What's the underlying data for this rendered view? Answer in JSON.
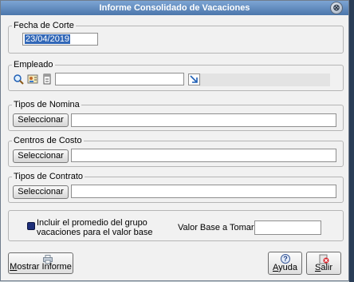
{
  "window": {
    "title": "Informe Consolidado de Vacaciones",
    "close_glyph": "⊗"
  },
  "fecha_corte": {
    "label": "Fecha de Corte",
    "value": "23/04/2019"
  },
  "empleado": {
    "label": "Empleado",
    "value": "",
    "icons": [
      "search-icon",
      "card-icon",
      "document-icon",
      "pick-arrow-icon"
    ]
  },
  "tipos_nomina": {
    "label": "Tipos de Nomina",
    "button": "Seleccionar",
    "value": ""
  },
  "centros_costo": {
    "label": "Centros de Costo",
    "button": "Seleccionar",
    "value": ""
  },
  "tipos_contrato": {
    "label": "Tipos de Contrato",
    "button": "Seleccionar",
    "value": ""
  },
  "promedio": {
    "checkbox_line1": "Incluir el promedio del grupo",
    "checkbox_line2": "vacaciones para el valor base",
    "checked": true,
    "valor_base_label": "Valor Base a Tomar",
    "valor_base_value": ""
  },
  "footer": {
    "mostrar_prefix": "M",
    "mostrar_rest": "ostrar Informe",
    "ayuda_prefix": "A",
    "ayuda_rest": "yuda",
    "salir_prefix": "S",
    "salir_rest": "alir",
    "mostrar_icon": "printer-icon",
    "ayuda_icon": "help-icon",
    "salir_icon": "exit-icon"
  },
  "colors": {
    "accent": "#3167b7",
    "title_top": "#7da5d4",
    "title_bottom": "#4b76ab"
  }
}
